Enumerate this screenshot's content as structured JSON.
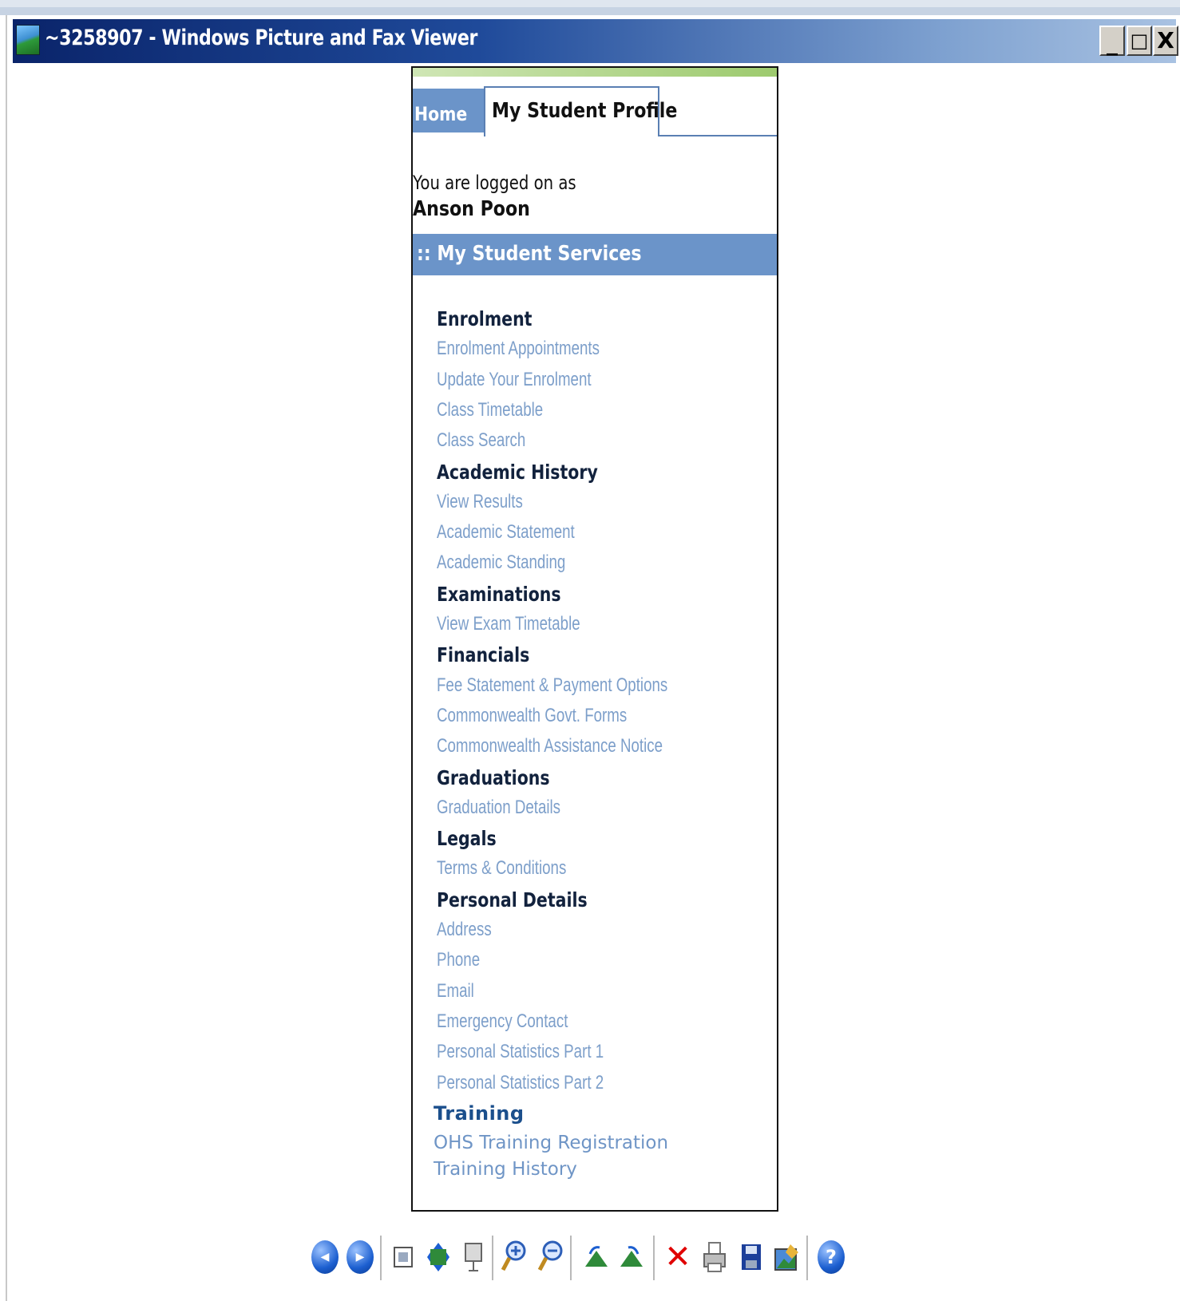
{
  "window": {
    "title": "~3258907 - Windows Picture and Fax Viewer",
    "min_label": "_",
    "max_label": "□",
    "close_label": "X"
  },
  "tabs": {
    "home": "Home",
    "active": "My Student Profile"
  },
  "login": {
    "label": "You are logged on as",
    "user": "Anson Poon"
  },
  "services_title": ":: My Student Services",
  "menu": [
    {
      "type": "head",
      "text": "Enrolment"
    },
    {
      "type": "link",
      "text": "Enrolment Appointments"
    },
    {
      "type": "link",
      "text": "Update Your Enrolment"
    },
    {
      "type": "link",
      "text": "Class Timetable"
    },
    {
      "type": "link",
      "text": "Class Search"
    },
    {
      "type": "head",
      "text": "Academic History"
    },
    {
      "type": "link",
      "text": "View Results"
    },
    {
      "type": "link",
      "text": "Academic Statement"
    },
    {
      "type": "link",
      "text": "Academic Standing"
    },
    {
      "type": "head",
      "text": "Examinations"
    },
    {
      "type": "link",
      "text": "View Exam Timetable"
    },
    {
      "type": "head",
      "text": "Financials"
    },
    {
      "type": "link",
      "text": "Fee Statement & Payment Options"
    },
    {
      "type": "link",
      "text": "Commonwealth Govt. Forms"
    },
    {
      "type": "link",
      "text": "Commonwealth Assistance Notice"
    },
    {
      "type": "head",
      "text": "Graduations"
    },
    {
      "type": "link",
      "text": "Graduation Details"
    },
    {
      "type": "head",
      "text": "Legals"
    },
    {
      "type": "link",
      "text": "Terms & Conditions"
    },
    {
      "type": "head",
      "text": "Personal Details"
    },
    {
      "type": "link",
      "text": "Address"
    },
    {
      "type": "link",
      "text": "Phone"
    },
    {
      "type": "link",
      "text": "Email"
    },
    {
      "type": "link",
      "text": "Emergency Contact"
    },
    {
      "type": "link",
      "text": "Personal Statistics Part 1"
    },
    {
      "type": "link",
      "text": "Personal Statistics Part 2"
    },
    {
      "type": "head2",
      "text": "Training"
    },
    {
      "type": "link2",
      "text": "OHS Training Registration"
    },
    {
      "type": "link2",
      "text": "Training History"
    }
  ],
  "toolbar": {
    "prev_label": "◀",
    "next_label": "▶",
    "delete_label": "✕",
    "help_label": "?"
  },
  "colors": {
    "titlebar": "#0a246a",
    "tab_blue": "#6b94c9",
    "link": "#7d9fca",
    "heading": "#12223d"
  }
}
